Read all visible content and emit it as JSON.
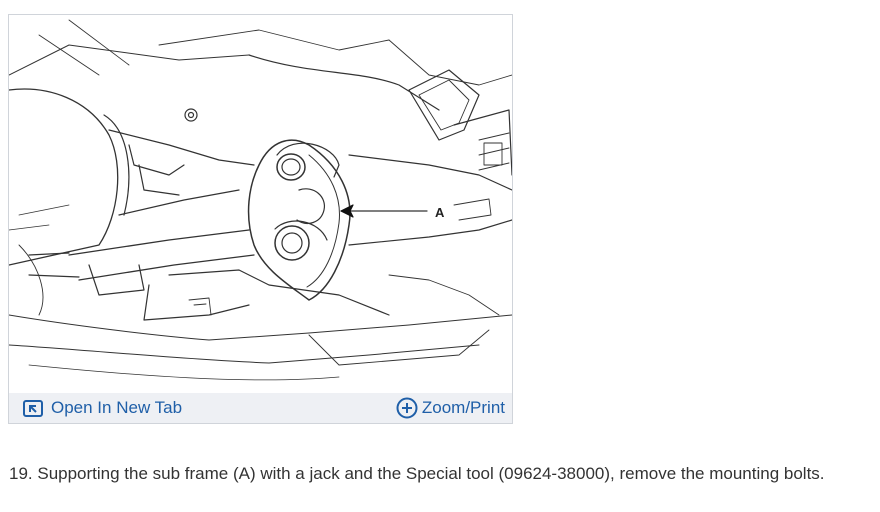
{
  "figure": {
    "callout_label": "A",
    "toolbar": {
      "open_new_tab_label": "Open In New Tab",
      "zoom_print_label": "Zoom/Print",
      "open_new_tab_icon": "open-new-tab-icon",
      "zoom_icon": "plus-circle-icon",
      "link_color": "#1f5fa8",
      "toolbar_bg": "#eef0f4"
    }
  },
  "step": {
    "text": "19. Supporting the sub frame (A) with a jack and the Special tool (09624-38000), remove the mounting bolts."
  }
}
